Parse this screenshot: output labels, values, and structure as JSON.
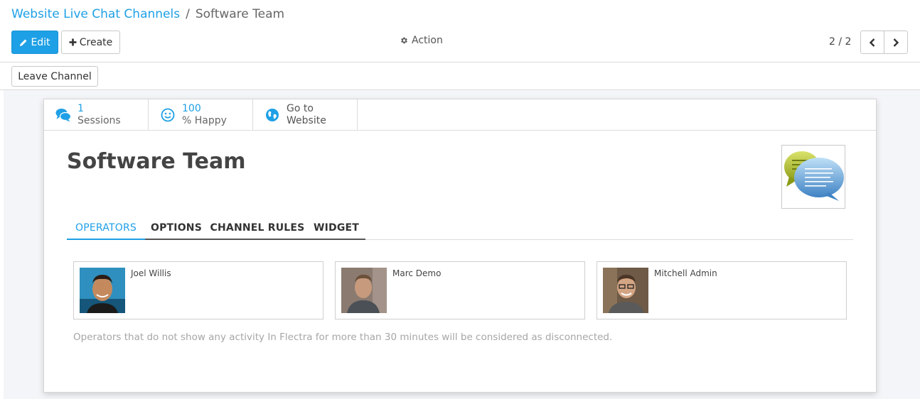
{
  "breadcrumb": {
    "parent": "Website Live Chat Channels",
    "separator": "/",
    "current": "Software Team"
  },
  "toolbar": {
    "edit_label": "Edit",
    "create_label": "Create",
    "action_label": "Action"
  },
  "pager": {
    "value": "2 / 2"
  },
  "statusbar": {
    "leave_label": "Leave Channel"
  },
  "stat_buttons": {
    "sessions": {
      "value": "1",
      "label": "Sessions"
    },
    "happy": {
      "value": "100",
      "label": "% Happy"
    },
    "website": {
      "line1": "Go to",
      "line2": "Website"
    }
  },
  "record": {
    "title": "Software Team"
  },
  "tabs": [
    {
      "label": "OPERATORS"
    },
    {
      "label": "OPTIONS"
    },
    {
      "label": "CHANNEL RULES"
    },
    {
      "label": "WIDGET"
    }
  ],
  "operators": [
    {
      "name": "Joel Willis"
    },
    {
      "name": "Marc Demo"
    },
    {
      "name": "Mitchell Admin"
    }
  ],
  "help_text": "Operators that do not show any activity In Flectra for more than 30 minutes will be considered as disconnected.",
  "colors": {
    "accent": "#1ea0e6",
    "text": "#4c4c4c",
    "muted": "#a6a6a6",
    "background": "#f3f5f8"
  }
}
